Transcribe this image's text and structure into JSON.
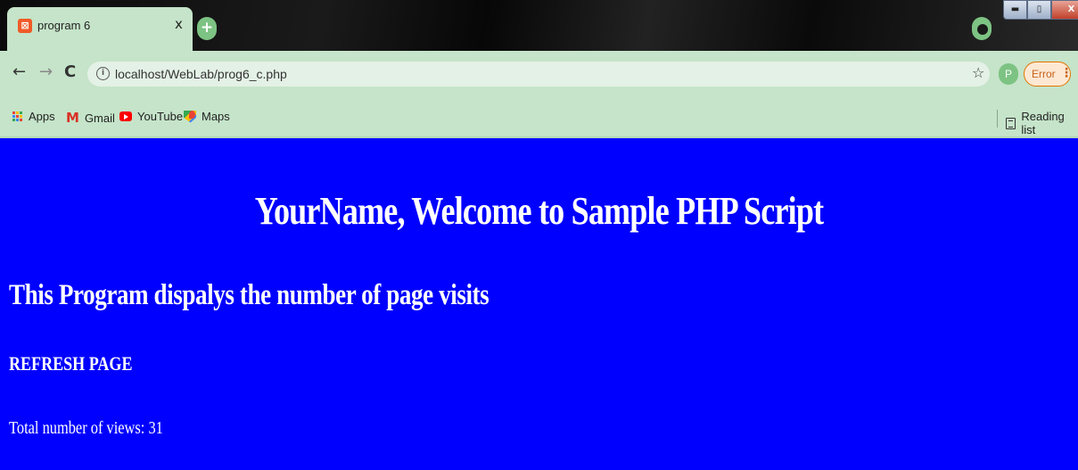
{
  "browser": {
    "tab": {
      "title": "program 6",
      "close": "x",
      "favicon_letter": "⊠"
    },
    "new_tab": "+",
    "window_controls": {
      "minimize": "▬",
      "maximize": "▯",
      "close": "X"
    },
    "toolbar": {
      "back": "←",
      "forward": "→",
      "reload": "C",
      "info": "i",
      "url": "localhost/WebLab/prog6_c.php",
      "star": "☆",
      "profile_initial": "P",
      "error_label": "Error",
      "menu": "⋮"
    },
    "bookmarks": [
      {
        "label": "Apps",
        "icon": "apps-grid-icon"
      },
      {
        "label": "Gmail",
        "icon": "gmail-icon"
      },
      {
        "label": "YouTube",
        "icon": "youtube-icon"
      },
      {
        "label": "Maps",
        "icon": "maps-icon"
      }
    ],
    "reading_list": "Reading list",
    "colors": {
      "chrome": "#c5e4c9",
      "accent": "#7dc383",
      "error": "#e37400"
    }
  },
  "content": {
    "heading": "YourName, Welcome to Sample PHP Script",
    "subheading": "This Program dispalys the number of page visits",
    "refresh_link": "REFRESH PAGE",
    "views_text": "Total number of views: 31",
    "background_color": "#0000ff",
    "text_color": "#ffffff"
  }
}
